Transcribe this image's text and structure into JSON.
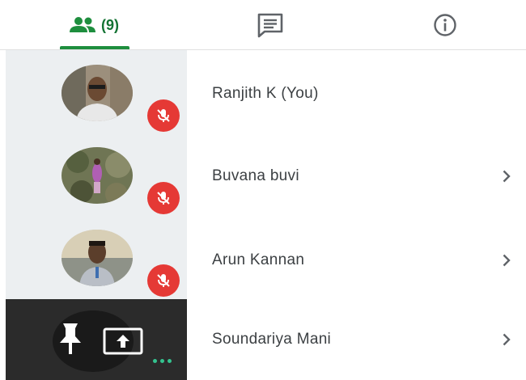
{
  "tabs": {
    "people": {
      "icon": "people-icon",
      "count": "(9)",
      "active": true
    },
    "chat": {
      "icon": "chat-icon"
    },
    "info": {
      "icon": "info-icon"
    }
  },
  "participants": [
    {
      "name": "Ranjith K (You)",
      "muted": true,
      "has_chevron": false
    },
    {
      "name": "Buvana buvi",
      "muted": true,
      "has_chevron": true
    },
    {
      "name": "Arun Kannan",
      "muted": true,
      "has_chevron": true
    },
    {
      "name": "Soundariya Mani",
      "muted": false,
      "has_chevron": true
    }
  ],
  "tile_controls": [
    "pin-icon",
    "present-screen-icon",
    "more-dots-icon"
  ],
  "colors": {
    "accent": "#1e8e3e",
    "mute_badge": "#e53935",
    "dots": "#34c38f"
  }
}
